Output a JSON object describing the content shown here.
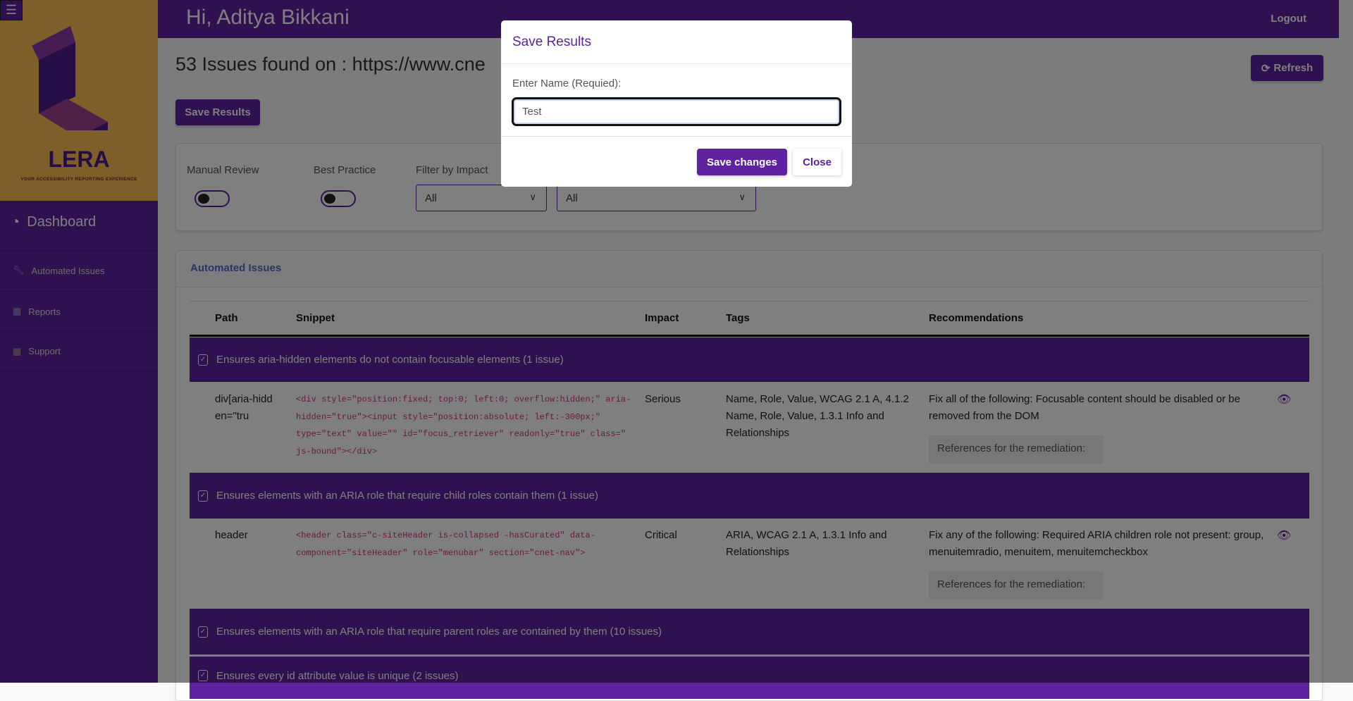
{
  "sidebar": {
    "logo_text": "LERA",
    "tagline": "YOUR ACCESSIBILITY REPORTING EXPERIENCE",
    "dashboard": "Dashboard",
    "items": [
      {
        "label": "Automated Issues",
        "icon": "wrench-icon"
      },
      {
        "label": "Reports",
        "icon": "table-icon"
      },
      {
        "label": "Support",
        "icon": "table-icon"
      }
    ]
  },
  "header": {
    "greeting": "Hi, Aditya Bikkani",
    "logout": "Logout"
  },
  "main": {
    "title": "53 Issues found on : https://www.cne",
    "save_results": "Save Results",
    "refresh": "Refresh",
    "filters": {
      "manual_review": "Manual Review",
      "best_practice": "Best Practice",
      "filter_by_impact": "Filter by Impact",
      "impact_value": "All",
      "second_value": "All",
      "manual_review_on": false,
      "best_practice_on": false
    },
    "card_title": "Automated Issues",
    "columns": [
      "Path",
      "Snippet",
      "Impact",
      "Tags",
      "Recommendations"
    ],
    "groups": [
      {
        "title": "Ensures aria-hidden elements do not contain focusable elements (1 issue)",
        "rows": [
          {
            "path": "div[aria-hidden=\"tru",
            "snippet": "<div style=\"position:fixed; top:0; left:0; overflow:hidden;\" aria-hidden=\"true\"><input style=\"position:absolute; left:-300px;\" type=\"text\" value=\"\" id=\"focus_retriever\" readonly=\"true\" class=\" js-bound\"></div>",
            "impact": "Serious",
            "tags": "Name, Role, Value, WCAG 2.1 A, 4.1.2 Name, Role, Value, 1.3.1 Info and Relationships",
            "recommendation": "Fix all of the following: Focusable content should be disabled or be removed from the DOM",
            "references": "References for the remediation:"
          }
        ]
      },
      {
        "title": "Ensures elements with an ARIA role that require child roles contain them (1 issue)",
        "rows": [
          {
            "path": "header",
            "snippet": "<header class=\"c-siteHeader is-collapsed -hasCurated\" data-component=\"siteHeader\" role=\"menubar\" section=\"cnet-nav\">",
            "impact": "Critical",
            "tags": "ARIA, WCAG 2.1 A, 1.3.1 Info and Relationships",
            "recommendation": "Fix any of the following: Required ARIA children role not present: group, menuitemradio, menuitem, menuitemcheckbox",
            "references": "References for the remediation:"
          }
        ]
      },
      {
        "title": "Ensures elements with an ARIA role that require parent roles are contained by them (10 issues)"
      },
      {
        "title": "Ensures every id attribute value is unique (2 issues)"
      }
    ]
  },
  "modal": {
    "title": "Save Results",
    "label": "Enter Name (Requied):",
    "input_value": "Test",
    "save": "Save changes",
    "close": "Close"
  },
  "colors": {
    "brand": "#5e21a0",
    "logo_bg": "#fdbd52",
    "code": "#d63384"
  }
}
